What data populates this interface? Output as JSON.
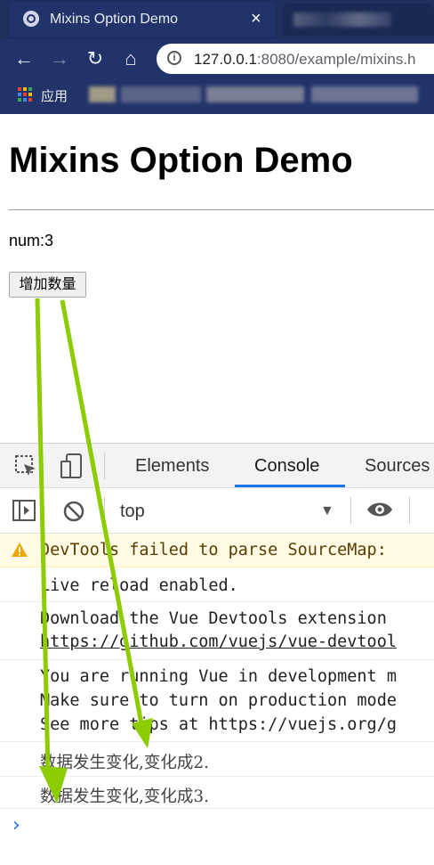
{
  "browser": {
    "tab_title": "Mixins Option Demo",
    "tab_close": "×",
    "url_host": "127.0.0.1",
    "url_rest": ":8080/example/mixins.h",
    "apps_label": "应用",
    "nav": {
      "back": "←",
      "forward": "→",
      "reload": "↻",
      "home": "⌂"
    }
  },
  "page": {
    "title": "Mixins Option Demo",
    "num_text": "num:3",
    "button_label": "增加数量"
  },
  "devtools": {
    "tabs": [
      "Elements",
      "Console",
      "Sources"
    ],
    "active_tab": "Console",
    "context": "top",
    "console": {
      "warning": "DevTools failed to parse SourceMap:",
      "messages": [
        {
          "lines": [
            "Live reload enabled."
          ]
        },
        {
          "lines": [
            "Download the Vue Devtools extension",
            "https://github.com/vuejs/vue-devtool"
          ]
        },
        {
          "lines": [
            "You are running Vue in development m",
            "Make sure to turn on production mode",
            "See more tips at https://vuejs.org/g"
          ]
        },
        {
          "lines": [
            "数据发生变化,变化成2."
          ]
        },
        {
          "lines": [
            "数据发生变化,变化成3."
          ]
        }
      ],
      "prompt": "›"
    }
  },
  "colors": {
    "chrome_dark": "#1f2f5e",
    "chrome": "#22336a",
    "accent_blue": "#1a73e8",
    "annotation_arrow": "#8ccc00"
  },
  "icons": [
    "globe-icon",
    "close-icon",
    "back-arrow-icon",
    "forward-arrow-icon",
    "reload-icon",
    "home-icon",
    "info-icon",
    "apps-grid-icon",
    "inspect-element-icon",
    "device-toolbar-icon",
    "console-sidebar-icon",
    "clear-console-icon",
    "eye-icon",
    "warning-icon",
    "chevron-right-icon"
  ]
}
